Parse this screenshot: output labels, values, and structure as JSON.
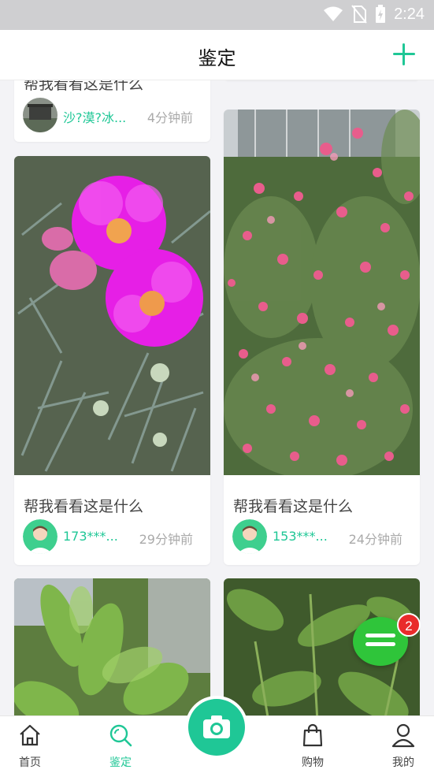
{
  "status_bar": {
    "time": "2:24"
  },
  "header": {
    "title": "鉴定"
  },
  "feed": {
    "cards": [
      {
        "title": "帮我看看这是什么",
        "user": "沙?漠?冰...",
        "time": "4分钟前"
      },
      {
        "title": "帮我看看这是什么",
        "user": "173***...",
        "time": "29分钟前"
      },
      {
        "title": "帮我看看这是什么",
        "user": "153***...",
        "time": "24分钟前"
      }
    ]
  },
  "fab": {
    "badge": "2"
  },
  "tabbar": {
    "tabs": [
      {
        "label": "首页",
        "icon": "home-icon"
      },
      {
        "label": "鉴定",
        "icon": "search-icon"
      },
      {
        "label": "购物",
        "icon": "shopping-bag-icon"
      },
      {
        "label": "我的",
        "icon": "user-icon"
      }
    ],
    "camera_icon": "camera-icon"
  },
  "colors": {
    "accent": "#1fc796",
    "fab": "#2fc53a",
    "badge": "#e92b2b"
  }
}
